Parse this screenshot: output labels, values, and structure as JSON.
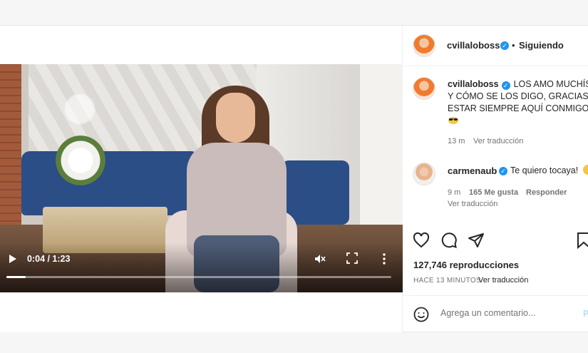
{
  "video": {
    "time": "0:04 / 1:23",
    "progress": 0.05
  },
  "header": {
    "username": "cvillaloboss",
    "separator": "•",
    "follow_label": "Siguiendo"
  },
  "caption": {
    "username": "cvillaloboss",
    "line1": "LOS AMO MUCHÍS",
    "line2": "Y CÓMO SE LOS DIGO, GRACIAS P",
    "line3": "ESTAR SIEMPRE AQUÍ CONMIGO",
    "time": "13 m",
    "translate": "Ver traducción"
  },
  "comment": {
    "username": "carmenaub",
    "text": "Te quiero tocaya!",
    "time": "9 m",
    "likes": "165 Me gusta",
    "reply": "Responder",
    "translate": "Ver traducción"
  },
  "stats": {
    "views": "127,746 reproducciones",
    "ago": "HACE 13 MINUTOS",
    "translate": "Ver traducción"
  },
  "add_comment": {
    "placeholder": "Agrega un comentario...",
    "publish": "P"
  },
  "colors": {
    "verified": "#1f95f2",
    "muted_text": "#737373",
    "publish_disabled": "#b2dffc"
  }
}
